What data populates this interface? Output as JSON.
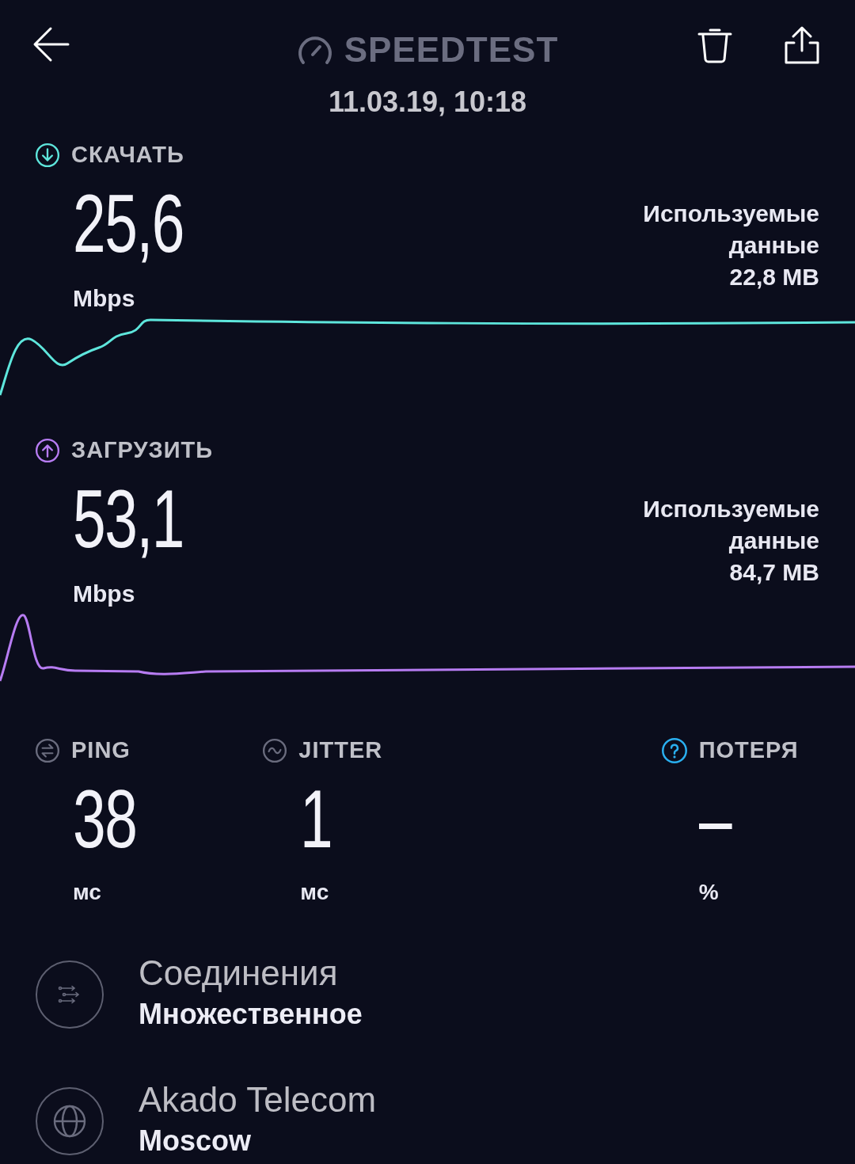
{
  "header": {
    "title": "SPEEDTEST",
    "date": "11.03.19, 10:18"
  },
  "tests": [
    {
      "kind": "download",
      "label": "СКАЧАТЬ",
      "value": "25,6",
      "unit": "Mbps",
      "data_label": "Используемые данные",
      "data_value": "22,8 MB"
    },
    {
      "kind": "upload",
      "label": "ЗАГРУЗИТЬ",
      "value": "53,1",
      "unit": "Mbps",
      "data_label": "Используемые данные",
      "data_value": "84,7 MB"
    }
  ],
  "metrics": [
    {
      "kind": "ping",
      "label": "PING",
      "value": "38",
      "unit": "мс"
    },
    {
      "kind": "jitter",
      "label": "JITTER",
      "value": "1",
      "unit": "мс"
    },
    {
      "kind": "loss",
      "label": "ПОТЕРЯ",
      "value": "–",
      "unit": "%"
    }
  ],
  "details": [
    {
      "kind": "connections",
      "title": "Соединения",
      "value": "Множественное"
    },
    {
      "kind": "provider",
      "title": "Akado Telecom",
      "value": "Moscow"
    }
  ]
}
